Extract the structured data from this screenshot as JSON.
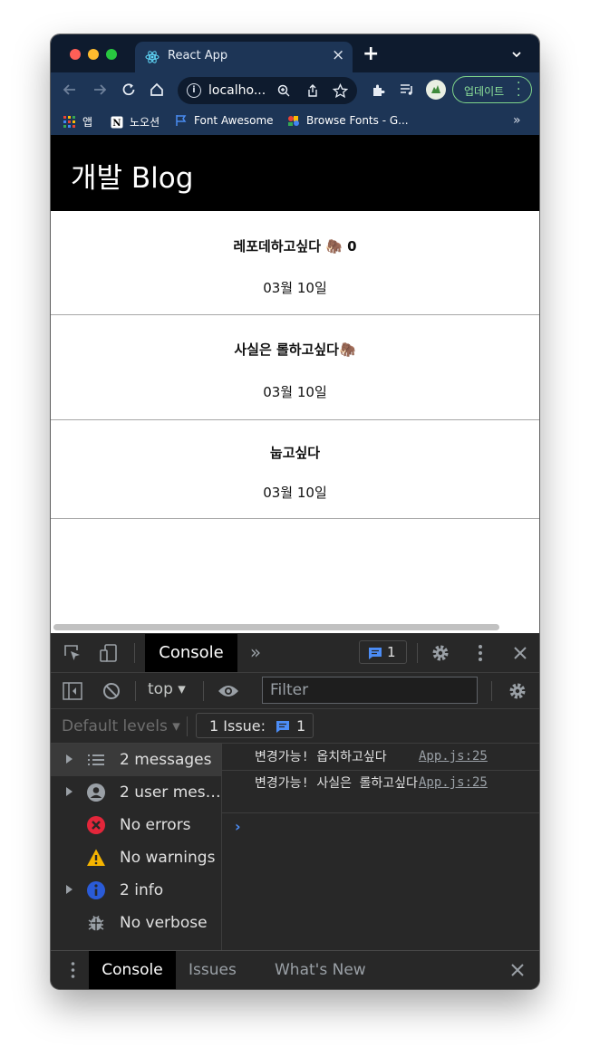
{
  "browser": {
    "tab_title": "React App",
    "new_tab": "+",
    "url": "localho...",
    "update_label": "업데이트",
    "bookmarks": [
      {
        "label": "앱"
      },
      {
        "label": "노오션"
      },
      {
        "label": "Font Awesome"
      },
      {
        "label": "Browse Fonts - G..."
      }
    ],
    "bookmarks_overflow": "»"
  },
  "page": {
    "title": "개발 Blog",
    "posts": [
      {
        "title": "레포데하고싶다 🦣 0",
        "date": "03월 10일"
      },
      {
        "title": "사실은 롤하고싶다🦣",
        "date": "03월 10일"
      },
      {
        "title": "눕고싶다",
        "date": "03월 10일"
      }
    ]
  },
  "devtools": {
    "active_tab": "Console",
    "more_tabs": "»",
    "issue_count": "1",
    "context": "top ▾",
    "filter_placeholder": "Filter",
    "levels": "Default levels ▾",
    "issues_label": "1 Issue:",
    "issues_count": "1",
    "sidebar": [
      {
        "label": "2 messages",
        "icon": "list-icon"
      },
      {
        "label": "2 user mes…",
        "icon": "user-icon"
      },
      {
        "label": "No errors",
        "icon": "error-icon"
      },
      {
        "label": "No warnings",
        "icon": "warning-icon"
      },
      {
        "label": "2 info",
        "icon": "info-icon"
      },
      {
        "label": "No verbose",
        "icon": "bug-icon"
      }
    ],
    "logs": [
      {
        "message": "변경가능! 옵치하고싶다",
        "source": "App.js:25"
      },
      {
        "message": "변경가능! 사실은 롤하고싶다",
        "source": "App.js:25"
      }
    ],
    "prompt": "›",
    "drawer_tabs": [
      "Console",
      "Issues",
      "What's New"
    ]
  },
  "colors": {
    "tabstrip": "#0e1b2e",
    "toolbar": "#1d3556",
    "devtools_bg": "#282828",
    "accent_blue": "#4c8df6"
  }
}
